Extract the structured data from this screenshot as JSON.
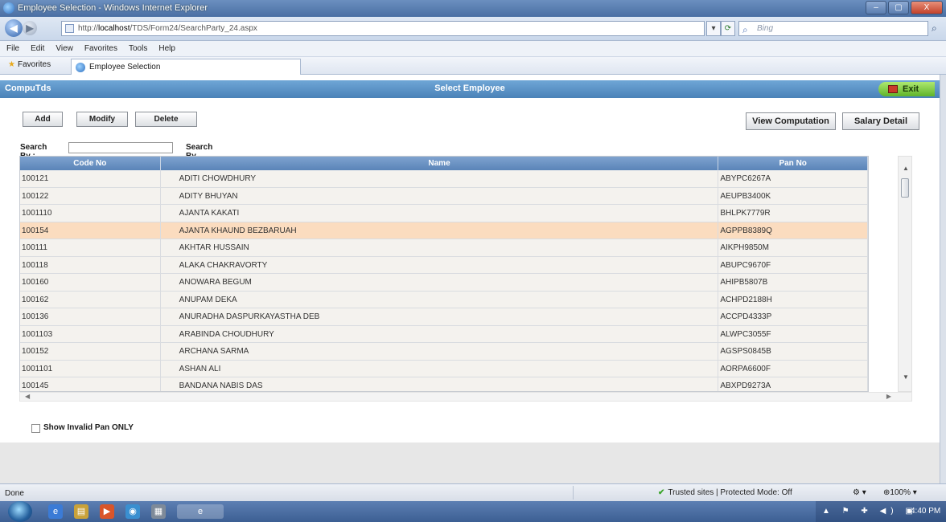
{
  "window": {
    "title": "Employee Selection - Windows Internet Explorer",
    "controls": {
      "minimize": "–",
      "maximize": "▢",
      "close": "X"
    }
  },
  "address": {
    "url_prefix": "http://",
    "url_host": "localhost",
    "url_path": "/TDS/Form24/SearchParty_24.aspx",
    "search_placeholder": "Bing"
  },
  "menu": [
    "File",
    "Edit",
    "View",
    "Favorites",
    "Tools",
    "Help"
  ],
  "favorites": {
    "label": "Favorites",
    "tab_title": "Employee Selection"
  },
  "app": {
    "brand": "CompuTds",
    "page_title": "Select Employee",
    "exit_label": "Exit"
  },
  "toolbar": {
    "add": "Add",
    "modify": "Modify",
    "delete": "Delete",
    "view_computation": "View Computation",
    "salary_detail": "Salary Detail"
  },
  "search": {
    "label": "Search By :",
    "value": "",
    "mode": "Search By :Name"
  },
  "grid": {
    "columns": [
      "Code No",
      "Name",
      "Pan No"
    ],
    "rows": [
      {
        "code": "100121",
        "name": "ADITI CHOWDHURY",
        "pan": "ABYPC6267A"
      },
      {
        "code": "100122",
        "name": "ADITY BHUYAN",
        "pan": "AEUPB3400K"
      },
      {
        "code": "1001110",
        "name": "AJANTA KAKATI",
        "pan": "BHLPK7779R"
      },
      {
        "code": "100154",
        "name": "AJANTA KHAUND BEZBARUAH",
        "pan": "AGPPB8389Q"
      },
      {
        "code": "100111",
        "name": "AKHTAR HUSSAIN",
        "pan": "AIKPH9850M"
      },
      {
        "code": "100118",
        "name": "ALAKA CHAKRAVORTY",
        "pan": "ABUPC9670F"
      },
      {
        "code": "100160",
        "name": "ANOWARA BEGUM",
        "pan": "AHIPB5807B"
      },
      {
        "code": "100162",
        "name": "ANUPAM DEKA",
        "pan": "ACHPD2188H"
      },
      {
        "code": "100136",
        "name": "ANURADHA DASPURKAYASTHA DEB",
        "pan": "ACCPD4333P"
      },
      {
        "code": "1001103",
        "name": "ARABINDA CHOUDHURY",
        "pan": "ALWPC3055F"
      },
      {
        "code": "100152",
        "name": "ARCHANA SARMA",
        "pan": "AGSPS0845B"
      },
      {
        "code": "1001101",
        "name": "ASHAN ALI",
        "pan": "AORPA6600F"
      },
      {
        "code": "100145",
        "name": "BANDANA NABIS DAS",
        "pan": "ABXPD9273A"
      }
    ],
    "selected_index": 3
  },
  "filter": {
    "show_invalid_pan_label": "Show Invalid Pan ONLY",
    "checked": false
  },
  "status": {
    "left": "Done",
    "zone": "Trusted sites | Protected Mode: Off",
    "zoom_ctrl": "⚙ ▾",
    "zoom": "⊕100% ▾"
  },
  "taskbar": {
    "clock": "4:40 PM",
    "tray_icons": "▲ ⚑ ✚ ◀) ▣"
  },
  "colors": {
    "header_blue": "#4a82b8",
    "grid_header": "#5a84b8",
    "selected_row": "#fbdcbf",
    "exit_green": "#5fb42b"
  }
}
